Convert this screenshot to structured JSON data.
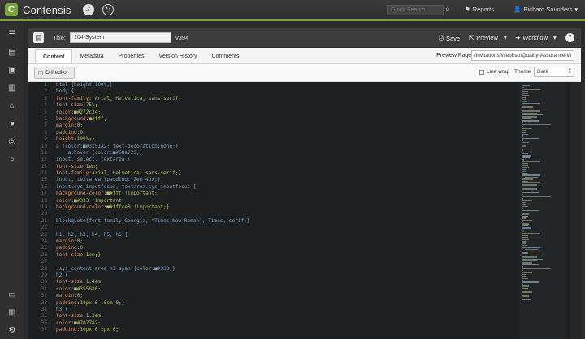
{
  "app": {
    "name": "Contensis"
  },
  "topbar": {
    "search_placeholder": "Quick Search",
    "reports": "Reports",
    "user": "Richard Saunders"
  },
  "sidebar": {
    "icons": [
      "menu-icon",
      "content-icon",
      "image-icon",
      "list-icon",
      "home-icon",
      "comment-icon",
      "globe-icon",
      "search-icon",
      "monitor-icon",
      "trash-icon",
      "gear-icon"
    ]
  },
  "entry": {
    "title_label": "Title:",
    "title_value": "104-System",
    "version": "v394",
    "save": "Save",
    "preview": "Preview",
    "workflow": "Workflow"
  },
  "tabs": [
    "Content",
    "Metadata",
    "Properties",
    "Version History",
    "Comments"
  ],
  "preview_page": {
    "label": "Preview Page:",
    "value": "/invitations/Webinar/Quality-Assurance-Web"
  },
  "editor": {
    "diff_label": "Diff editor",
    "line_wrap_label": "Line wrap",
    "theme_label": "Theme",
    "theme_value": "Dark"
  },
  "code_lines": [
    "html {height:100%;}",
    "body {",
    "font-family: Arial, Helvetica, sans-serif;",
    "font-size:75%;",
    "color:■#272c34;",
    "background:■#fff;",
    "margin:0;",
    "padding:0;",
    "height:100%;}",
    "a {color:■#3151A2; text-decoration:none;}",
    "    a:hover {color:■#68a729;}",
    "input, select, textarea {",
    "font-size:1em;",
    "font-family:Arial, Helvetica, sans-serif;}",
    "input, textarea {padding:.2em 4px;}",
    "input.sys_inputfocus, textarea.sys_inputfocus {",
    "background-color:■#fff !important;",
    "color:■#333 !important;",
    "background-color:■#fffce0 !important;}",
    "",
    "blockquote{font-family:Georgia, \"Times New Roman\", Times, serif;}",
    "",
    "h1, h2, h3, h4, h5, h6 {",
    "margin:0;",
    "padding:0;",
    "font-size:1em;}",
    "",
    ".sys_content-area h1 span {color:■#333;}",
    "h2 {",
    "font-size:1.4em;",
    "color:■#355686;",
    "margin:0;",
    "padding:10px 0 .6em 0;}",
    "h3 {",
    "font-size:1.3em;",
    "color:■#707782;",
    "padding:10px 0 2px 0;"
  ]
}
